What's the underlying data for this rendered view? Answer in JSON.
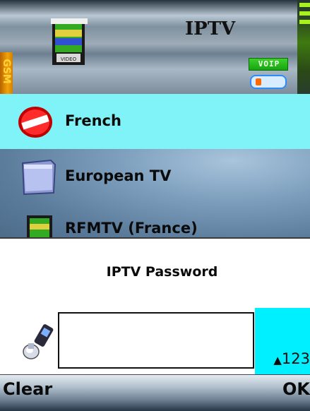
{
  "header": {
    "title": "IPTV",
    "network_tab": "GSM",
    "voip_badge": "VOIP",
    "icons": [
      "video-clapper-icon",
      "battery-icon",
      "signal-strength-icon"
    ]
  },
  "list": {
    "items": [
      {
        "label": "French",
        "icon": "no-entry-icon",
        "selected": true
      },
      {
        "label": "European TV",
        "icon": "folder-icon",
        "selected": false
      },
      {
        "label": "RFMTV (France)",
        "icon": "video-clapper-icon",
        "selected": false
      }
    ]
  },
  "dialog": {
    "title": "IPTV Password",
    "password_value": "",
    "input_mode": "123",
    "input_mode_icon": "caps-shift-icon",
    "phone_icon": "phone-handset-icon"
  },
  "softkeys": {
    "left": "Clear",
    "right": "OK"
  },
  "colors": {
    "selection": "#7ff3f8",
    "input_mode_bg": "#00f0ff",
    "voip_green": "#17a512"
  }
}
